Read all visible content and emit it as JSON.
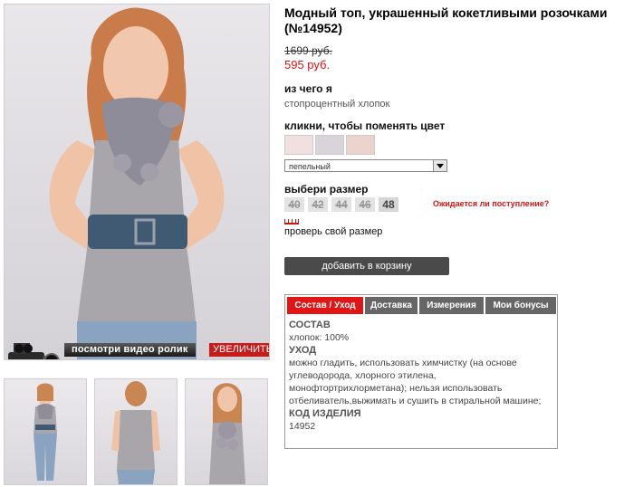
{
  "product": {
    "title": "Модный топ, украшенный кокетливыми розочками (№14952)",
    "old_price": "1699 руб.",
    "new_price": "595 руб."
  },
  "material": {
    "label": "из чего я",
    "value": "стопроцентный хлопок"
  },
  "color": {
    "label": "кликни, чтобы поменять цвет",
    "swatches": [
      "#f2dfe0",
      "#d9d4da",
      "#ecd3cd"
    ],
    "selected": "пепельный"
  },
  "size": {
    "label": "выбери размер",
    "options": [
      {
        "value": "40",
        "available": false
      },
      {
        "value": "42",
        "available": false
      },
      {
        "value": "44",
        "available": false
      },
      {
        "value": "46",
        "available": false
      },
      {
        "value": "48",
        "available": true
      }
    ],
    "notify": "Ожидается ли поступление?",
    "check_link": "проверь свой размер"
  },
  "cart_button": "добавить в корзину",
  "photo": {
    "video_link": "посмотри видео ролик",
    "zoom_link": "УВЕЛИЧИТЬ"
  },
  "tabs": [
    {
      "label": "Состав / Уход",
      "active": true
    },
    {
      "label": "Доставка",
      "active": false
    },
    {
      "label": "Измерения",
      "active": false
    },
    {
      "label": "Мои бонусы",
      "active": false
    }
  ],
  "tab_content": {
    "composition_heading": "СОСТАВ",
    "composition": "хлопок: 100%",
    "care_heading": "УХОД",
    "care": "можно гладить, использовать химчистку (на основе углеводорода, хлорного этилена, монофтортрихлорметана); нельзя использовать отбеливатель,выжимать и сушить в стиральной машине;",
    "code_heading": "КОД ИЗДЕЛИЯ",
    "code": "14952"
  },
  "colors": {
    "accent_red": "#e01515",
    "price_red": "#e01010",
    "button_dark": "#4a4a4a"
  }
}
